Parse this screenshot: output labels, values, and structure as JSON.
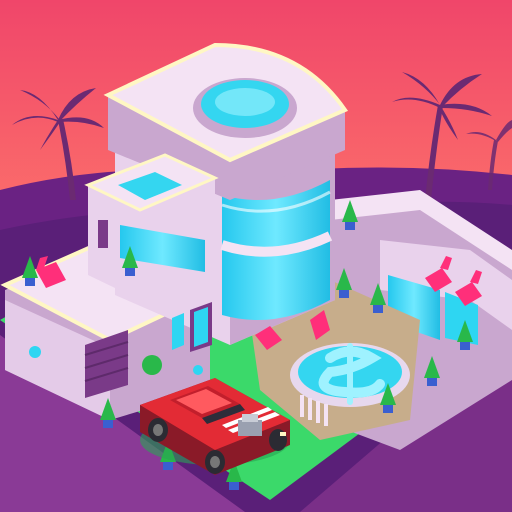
{
  "scene": {
    "name": "mansion-game-art",
    "colors": {
      "sky_top": "#f0466a",
      "sky_bottom": "#ffb067",
      "horizon_purple": "#5a1f78",
      "palm": "#6b2a72",
      "ground_grass": "#3bd96a",
      "ground_side": "#8a3a96",
      "wall_light": "#f4e3f4",
      "wall_shadow": "#c9a7cf",
      "wall_trim": "#fff7c4",
      "glass": "#2ed6f2",
      "glass_light": "#9ff2ff",
      "door": "#7a3a88",
      "lounger": "#ff2f7a",
      "plant": "#29b84a",
      "pot": "#3a5fd0",
      "car_body": "#e32b35",
      "car_dark": "#8a1a28",
      "car_stripe": "#ffffff",
      "pool_water": "#34d6f0",
      "patio": "#c7ad8b"
    },
    "icons": [
      "palm-tree-icon",
      "pool-icon",
      "dollar-pool-icon",
      "car-icon",
      "plant-icon",
      "lounger-icon"
    ]
  }
}
